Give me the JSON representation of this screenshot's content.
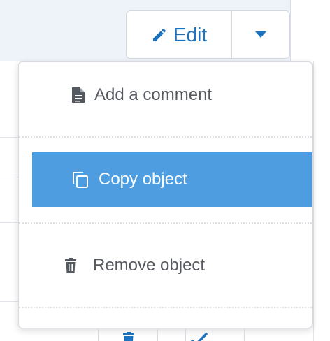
{
  "toolbar": {
    "edit_label": "Edit",
    "edit_icon": "pencil-icon",
    "dropdown_icon": "caret-down-icon"
  },
  "menu": {
    "items": [
      {
        "label": "Add a comment",
        "icon": "document-icon"
      },
      {
        "label": "Copy object",
        "icon": "copy-icon",
        "highlighted": true
      },
      {
        "label": "Remove object",
        "icon": "trash-icon"
      }
    ]
  },
  "colors": {
    "accent": "#1e73be",
    "highlight": "#4e9de0",
    "text": "#555a60"
  }
}
